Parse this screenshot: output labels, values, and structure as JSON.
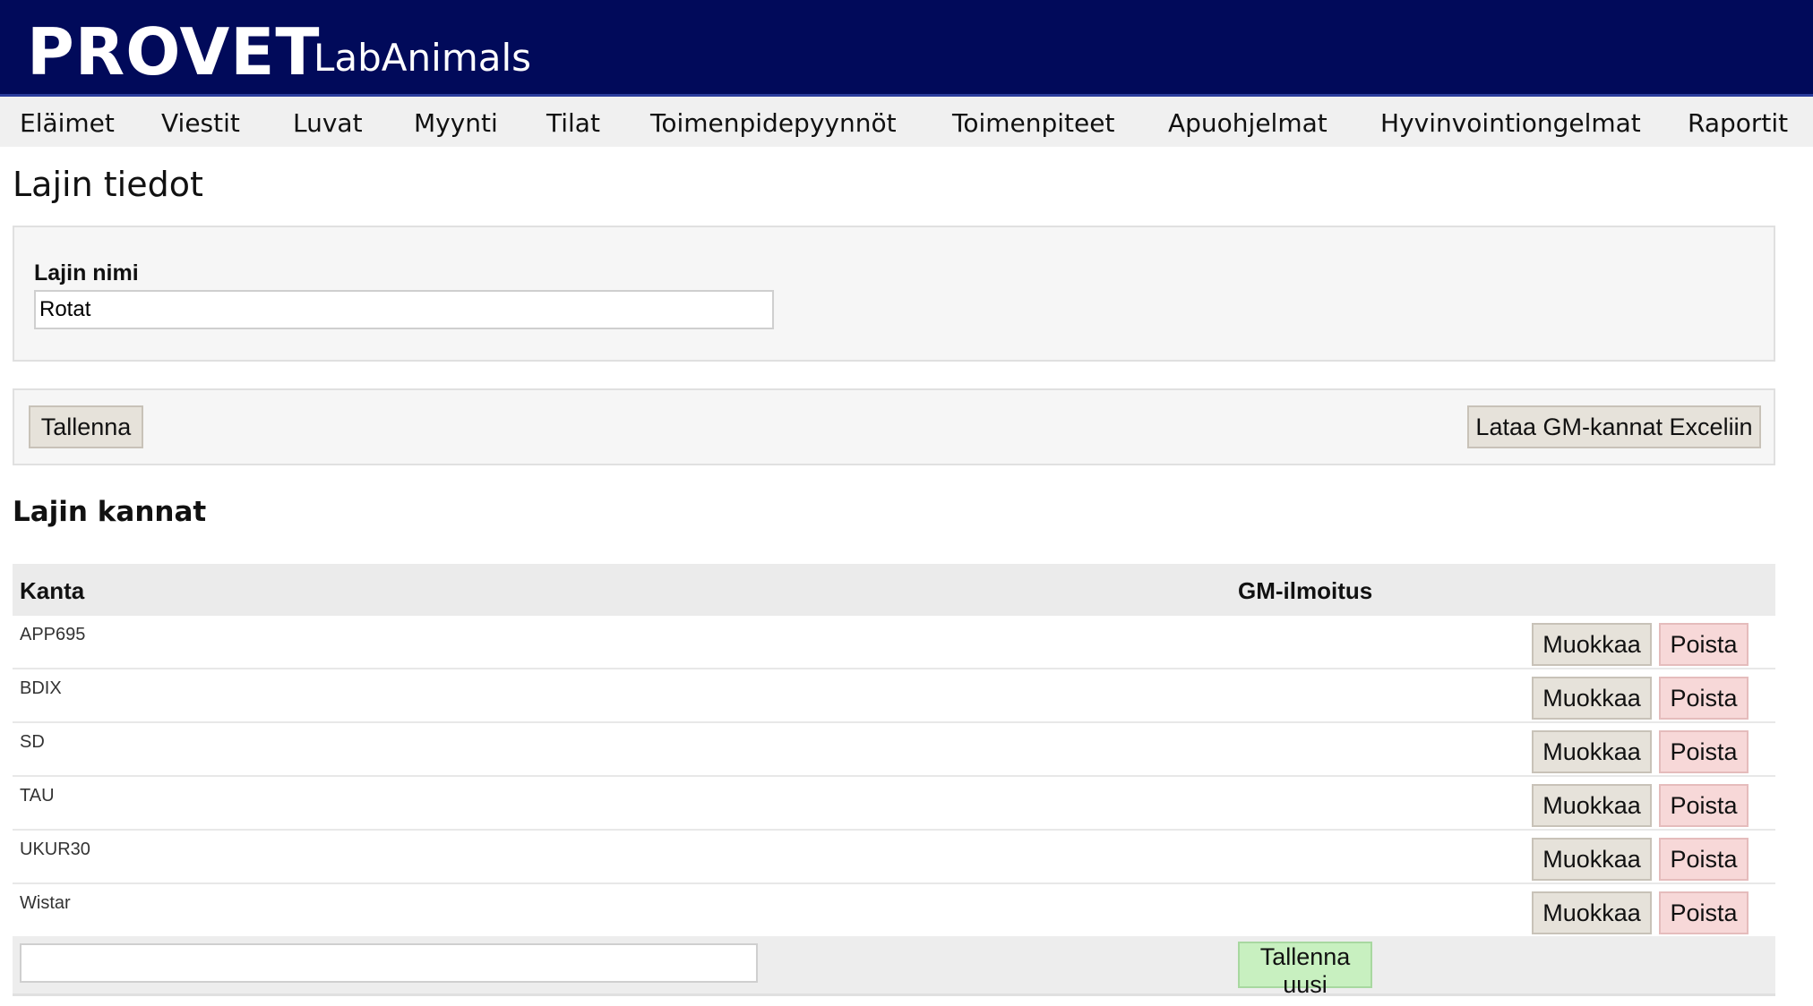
{
  "header": {
    "brand": "PROVET",
    "product": "LabAnimals"
  },
  "nav": {
    "items": [
      {
        "label": "Eläimet"
      },
      {
        "label": "Viestit"
      },
      {
        "label": "Luvat"
      },
      {
        "label": "Myynti"
      },
      {
        "label": "Tilat"
      },
      {
        "label": "Toimenpidepyynnöt"
      },
      {
        "label": "Toimenpiteet"
      },
      {
        "label": "Apuohjelmat"
      },
      {
        "label": "Hyvinvointiongelmat"
      },
      {
        "label": "Raportit"
      }
    ]
  },
  "page": {
    "title": "Lajin tiedot"
  },
  "species_form": {
    "name_label": "Lajin nimi",
    "name_value": "Rotat"
  },
  "actions": {
    "save_label": "Tallenna",
    "export_label": "Lataa GM-kannat Exceliin"
  },
  "strains": {
    "section_title": "Lajin kannat",
    "columns": [
      "Kanta",
      "GM-ilmoitus"
    ],
    "rows": [
      {
        "name": "APP695",
        "gm": ""
      },
      {
        "name": "BDIX",
        "gm": ""
      },
      {
        "name": "SD",
        "gm": ""
      },
      {
        "name": "TAU",
        "gm": ""
      },
      {
        "name": "UKUR30",
        "gm": ""
      },
      {
        "name": "Wistar",
        "gm": ""
      }
    ],
    "edit_label": "Muokkaa",
    "delete_label": "Poista",
    "new_value": "",
    "save_new_label": "Tallenna uusi"
  },
  "colors": {
    "header_bg": "#010a5a",
    "nav_bg": "#f0f0f0",
    "danger_btn": "#f7d8d8",
    "success_btn": "#c8f0c0"
  }
}
